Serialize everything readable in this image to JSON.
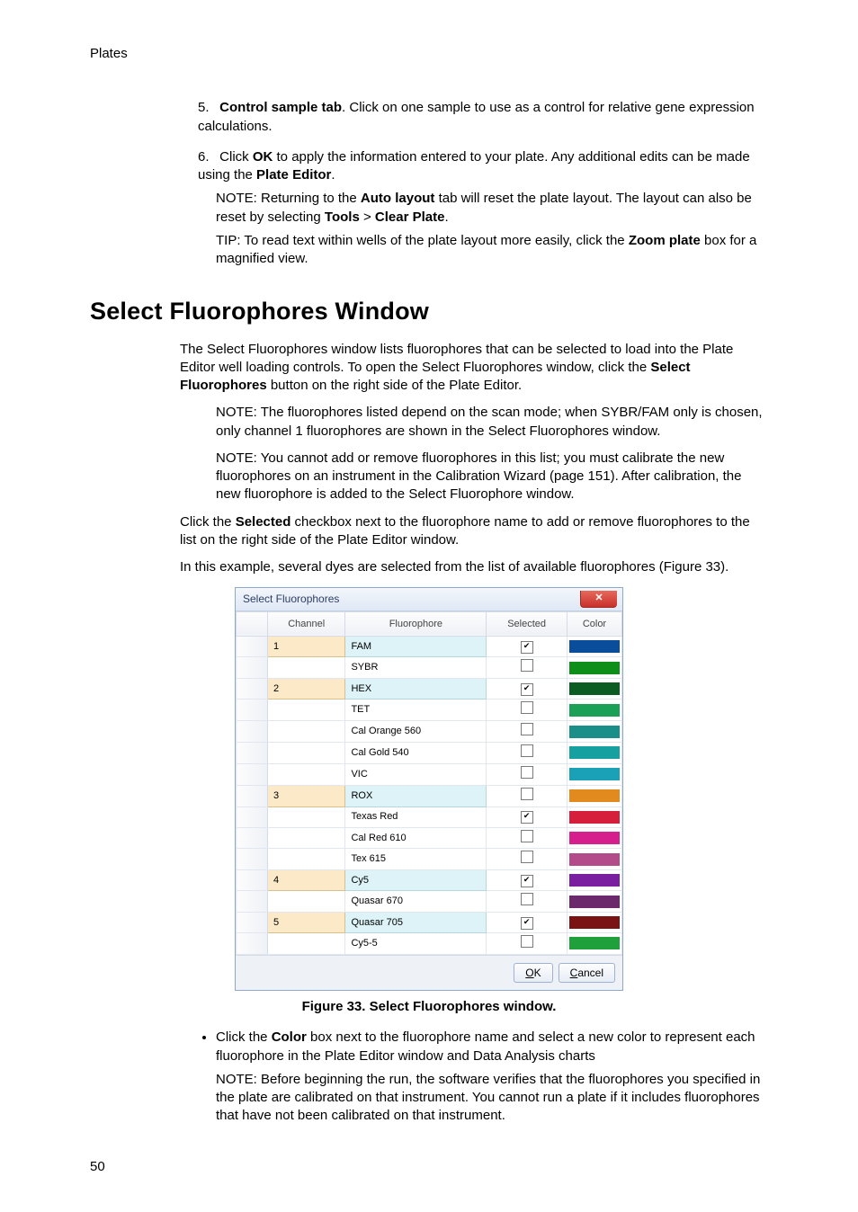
{
  "header": {
    "breadcrumb": "Plates"
  },
  "steps": [
    {
      "num": "5.",
      "lead_bold": "Control sample tab",
      "lead_after": ". Click on one sample to use as a control for relative gene expression calculations."
    },
    {
      "num": "6.",
      "lead_before": "Click ",
      "lead_bold": "OK",
      "lead_after": " to apply the information entered to your plate. Any additional edits can be made using the ",
      "lead_bold2": "Plate Editor",
      "lead_after2": ".",
      "note1_a": "NOTE: Returning to the ",
      "note1_b": "Auto layout",
      "note1_c": " tab will reset the plate layout. The layout can also be reset by selecting ",
      "note1_d": "Tools",
      "note1_e": " > ",
      "note1_f": "Clear Plate",
      "note1_g": ".",
      "tip_a": "TIP: To read text within wells of the plate layout more easily, click the ",
      "tip_b": "Zoom plate",
      "tip_c": " box for a magnified view."
    }
  ],
  "section_heading": "Select Fluorophores Window",
  "intro_a": "The Select Fluorophores window lists fluorophores that can be selected to load into the Plate Editor well loading controls. To open the Select Fluorophores window, click the ",
  "intro_b": "Select Fluorophores",
  "intro_c": " button on the right side of the Plate Editor.",
  "note_scan": "NOTE: The fluorophores listed depend on the scan mode; when SYBR/FAM only is chosen, only channel 1 fluorophores are shown in the Select Fluorophores window.",
  "note_addremove": "NOTE: You cannot add or remove fluorophores in this list; you must calibrate the new fluorophores on an instrument in the Calibration Wizard (page 151). After calibration, the new fluorophore is added to the Select Fluorophore window.",
  "click_sel_a": "Click the ",
  "click_sel_b": "Selected",
  "click_sel_c": " checkbox next to the fluorophore name to add or remove fluorophores to the list on the right side of the Plate Editor window.",
  "example_line": "In this example, several dyes are selected from the list of available fluorophores (Figure 33).",
  "window": {
    "title": "Select Fluorophores",
    "close_glyph": "✕",
    "columns": {
      "ch": "Channel",
      "fl": "Fluorophore",
      "sel": "Selected",
      "col": "Color"
    },
    "rows": [
      {
        "ch": "1",
        "fl": "FAM",
        "sel": true,
        "color": "#0a4e9b",
        "startCh": true
      },
      {
        "ch": "",
        "fl": "SYBR",
        "sel": false,
        "color": "#0f8f1a"
      },
      {
        "ch": "2",
        "fl": "HEX",
        "sel": true,
        "color": "#0b5c22",
        "startCh": true
      },
      {
        "ch": "",
        "fl": "TET",
        "sel": false,
        "color": "#1aa057"
      },
      {
        "ch": "",
        "fl": "Cal Orange 560",
        "sel": false,
        "color": "#1a8f8a"
      },
      {
        "ch": "",
        "fl": "Cal Gold 540",
        "sel": false,
        "color": "#17a0a0"
      },
      {
        "ch": "",
        "fl": "VIC",
        "sel": false,
        "color": "#1aa0b7"
      },
      {
        "ch": "3",
        "fl": "ROX",
        "sel": false,
        "color": "#e38a1e",
        "startCh": true
      },
      {
        "ch": "",
        "fl": "Texas Red",
        "sel": true,
        "color": "#d61f3a"
      },
      {
        "ch": "",
        "fl": "Cal Red 610",
        "sel": false,
        "color": "#d61f8c"
      },
      {
        "ch": "",
        "fl": "Tex 615",
        "sel": false,
        "color": "#b34a8a"
      },
      {
        "ch": "4",
        "fl": "Cy5",
        "sel": true,
        "color": "#7a1fa0",
        "startCh": true
      },
      {
        "ch": "",
        "fl": "Quasar 670",
        "sel": false,
        "color": "#6b2a6b"
      },
      {
        "ch": "5",
        "fl": "Quasar 705",
        "sel": true,
        "color": "#7a1414",
        "startCh": true
      },
      {
        "ch": "",
        "fl": "Cy5-5",
        "sel": false,
        "color": "#1fa03a"
      }
    ],
    "ok": "OK",
    "ok_u": "O",
    "ok_rest": "K",
    "cancel": "Cancel",
    "cancel_u": "C",
    "cancel_rest": "ancel"
  },
  "figure_caption": "Figure 33. Select Fluorophores window.",
  "bullet_a": "Click the ",
  "bullet_b": "Color",
  "bullet_c": " box next to the fluorophore name and select a new color to represent each fluorophore in the Plate Editor window and Data Analysis charts",
  "bullet_note": "NOTE: Before beginning the run, the software verifies that the fluorophores you specified in the plate are calibrated on that instrument. You cannot run a plate if it includes fluorophores that have not been calibrated on that instrument.",
  "page_number": "50"
}
